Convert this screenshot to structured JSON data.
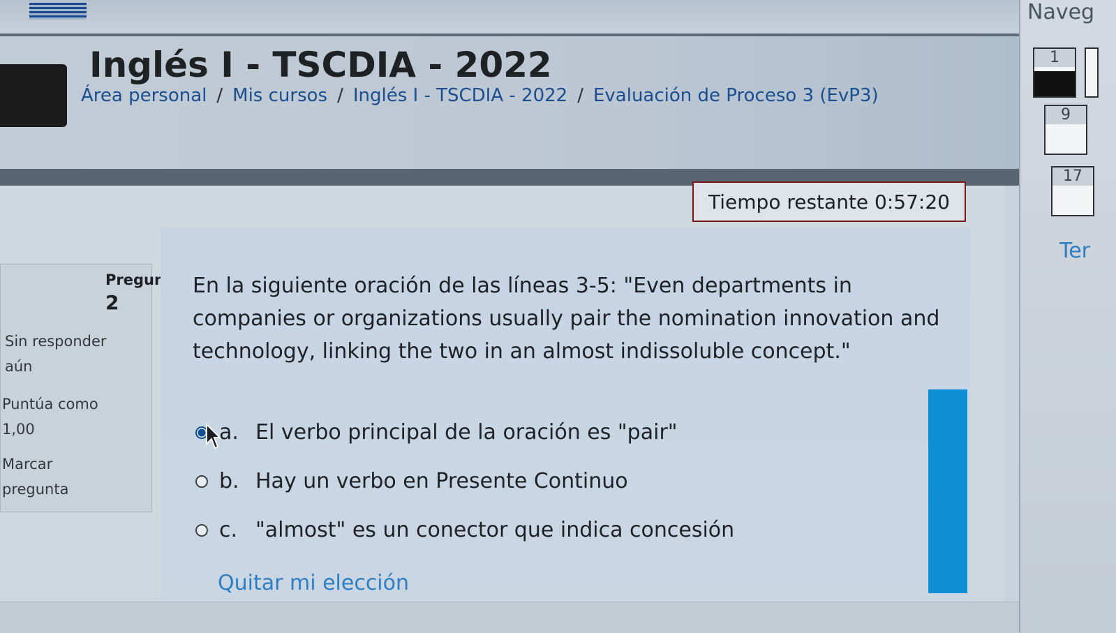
{
  "header": {
    "course_title": "Inglés I - TSCDIA - 2022",
    "breadcrumb": [
      "Área personal",
      "Mis cursos",
      "Inglés I - TSCDIA - 2022",
      "Evaluación de Proceso 3 (EvP3)"
    ],
    "separator": "/"
  },
  "timer": {
    "label": "Tiempo restante 0:57:20"
  },
  "question_info": {
    "label": "Pregun",
    "number": "2",
    "state": "Sin responder aún",
    "grade": "Puntúa como 1,00",
    "flag": "Marcar pregunta"
  },
  "question": {
    "text": "En la siguiente oración de las líneas 3-5: \"Even departments in  companies or organizations usually pair the nomination innovation and technology, linking the two in an almost indissoluble concept.\"",
    "answers": [
      {
        "letter": "a.",
        "text": "El verbo principal de la oración es \"pair\"",
        "selected": true
      },
      {
        "letter": "b.",
        "text": "Hay un verbo en Presente Continuo",
        "selected": false
      },
      {
        "letter": "c.",
        "text": "\"almost\" es un conector que indica concesión",
        "selected": false
      }
    ],
    "clear_choice": "Quitar mi elección"
  },
  "sidebar": {
    "title": "Naveg",
    "questions": [
      {
        "n": "1",
        "answered": true
      },
      {
        "n": "9",
        "answered": false
      },
      {
        "n": "17",
        "answered": false
      }
    ],
    "end_link": "Ter"
  },
  "colors": {
    "link": "#2f7ec2",
    "breadcrumb": "#1a4e8f",
    "timer_border": "#7a1818",
    "scrollbar": "#0f90d6"
  }
}
